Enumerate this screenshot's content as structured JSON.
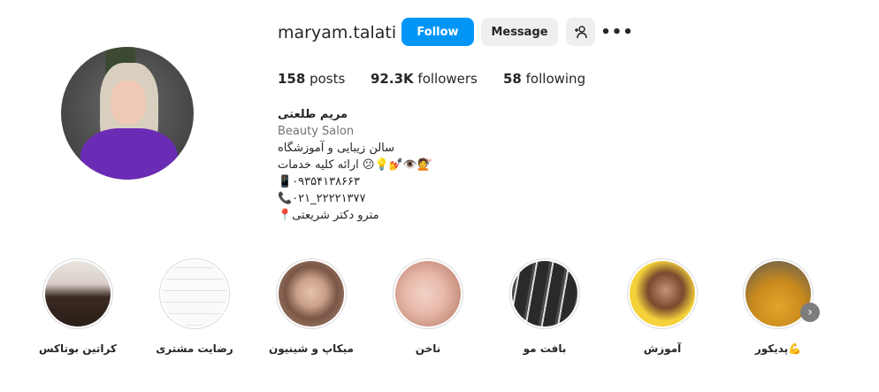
{
  "profile": {
    "username": "maryam.talati",
    "follow_label": "Follow",
    "message_label": "Message",
    "add_user_icon": "+👤",
    "more_icon": "•••"
  },
  "stats": {
    "posts_count": "158",
    "posts_label": "posts",
    "followers_count": "92.3K",
    "followers_label": "followers",
    "following_count": "58",
    "following_label": "following"
  },
  "bio": {
    "name": "مریم طلعتی",
    "category": "Beauty Salon",
    "line1": "سالن زیبایی و آموزشگاه",
    "line2": "ارائه کلیه خدمات 😕💡💅👁️💇",
    "line3": "📱۰۹۳۵۴۱۳۸۶۶۳",
    "line4": "📞۰۲۱_۲۲۲۲۱۳۷۷",
    "line5": "📍مترو دکتر شریعتی"
  },
  "highlights": [
    {
      "label": "پدیکور💪",
      "color": "#e3a52b"
    },
    {
      "label": "آموزش",
      "color": "#f5d23a"
    },
    {
      "label": "بافت مو",
      "color": "#3c3c3c"
    },
    {
      "label": "ناخن",
      "color": "#e7c1b8"
    },
    {
      "label": "میکاپ و شینیون",
      "color": "#b08c77"
    },
    {
      "label": "رضایت مشتری",
      "color": "#f4f4f4"
    },
    {
      "label": "کراتین بوتاکس",
      "color": "#d9cfc8"
    }
  ],
  "nav": {
    "next_icon": "›"
  }
}
